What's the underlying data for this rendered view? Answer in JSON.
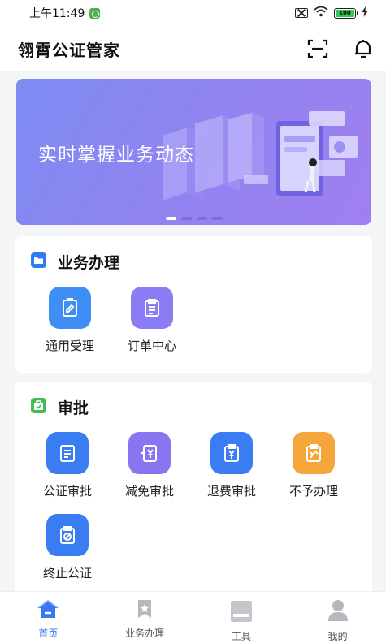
{
  "status_bar": {
    "time": "上午11:49",
    "battery": "100"
  },
  "header": {
    "title": "翎霄公证管家"
  },
  "banner": {
    "text": "实时掌握业务动态",
    "slide_count": 4,
    "active_slide": 1
  },
  "business": {
    "title": "业务办理",
    "items": [
      {
        "label": "通用受理",
        "icon": "form-edit-icon",
        "color": "#3f8ef5"
      },
      {
        "label": "订单中心",
        "icon": "order-list-icon",
        "color": "#8a7cf3"
      }
    ]
  },
  "approval": {
    "title": "审批",
    "items": [
      {
        "label": "公证审批",
        "icon": "document-list-icon",
        "color": "#3a7cf1"
      },
      {
        "label": "减免审批",
        "icon": "yen-reduce-icon",
        "color": "#8a74ef"
      },
      {
        "label": "退费审批",
        "icon": "yen-refund-icon",
        "color": "#3a7cf1"
      },
      {
        "label": "不予办理",
        "icon": "reject-doc-icon",
        "color": "#f5a63a"
      },
      {
        "label": "终止公证",
        "icon": "terminate-icon",
        "color": "#3a7cf1"
      }
    ]
  },
  "tabbar": {
    "tabs": [
      {
        "label": "首页",
        "icon": "home-icon",
        "active": true
      },
      {
        "label": "业务办理",
        "icon": "bookmark-icon",
        "active": false
      },
      {
        "label": "工具",
        "icon": "toolbox-icon",
        "active": false
      },
      {
        "label": "我的",
        "icon": "user-icon",
        "active": false
      }
    ]
  }
}
